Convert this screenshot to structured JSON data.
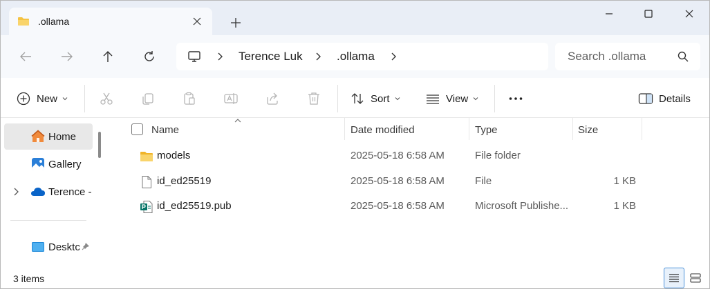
{
  "tab": {
    "title": ".ollama",
    "close_icon": "close-icon"
  },
  "window_controls": {
    "minimize": "minimize-icon",
    "maximize": "maximize-icon",
    "close": "close-icon"
  },
  "address_bar": {
    "breadcrumbs": [
      "Terence Luk",
      ".ollama"
    ],
    "search_placeholder": "Search .ollama"
  },
  "command_bar": {
    "new_label": "New",
    "sort_label": "Sort",
    "view_label": "View",
    "details_label": "Details"
  },
  "sidebar": {
    "items": [
      {
        "label": "Home",
        "icon": "home-icon"
      },
      {
        "label": "Gallery",
        "icon": "gallery-icon"
      },
      {
        "label": "Terence -",
        "icon": "onedrive-icon"
      },
      {
        "label": "Desktc",
        "icon": "desktop-icon"
      }
    ]
  },
  "columns": {
    "name": "Name",
    "date": "Date modified",
    "type": "Type",
    "size": "Size"
  },
  "files": [
    {
      "name": "models",
      "date": "2025-05-18 6:58 AM",
      "type": "File folder",
      "size": "",
      "icon": "folder-icon"
    },
    {
      "name": "id_ed25519",
      "date": "2025-05-18 6:58 AM",
      "type": "File",
      "size": "1 KB",
      "icon": "file-icon"
    },
    {
      "name": "id_ed25519.pub",
      "date": "2025-05-18 6:58 AM",
      "type": "Microsoft Publishe...",
      "size": "1 KB",
      "icon": "publisher-icon"
    }
  ],
  "status": {
    "item_count": "3 items"
  },
  "colors": {
    "titlebar_bg": "#e9eef6",
    "folder": "#f5c342",
    "accent": "#0067c0"
  }
}
